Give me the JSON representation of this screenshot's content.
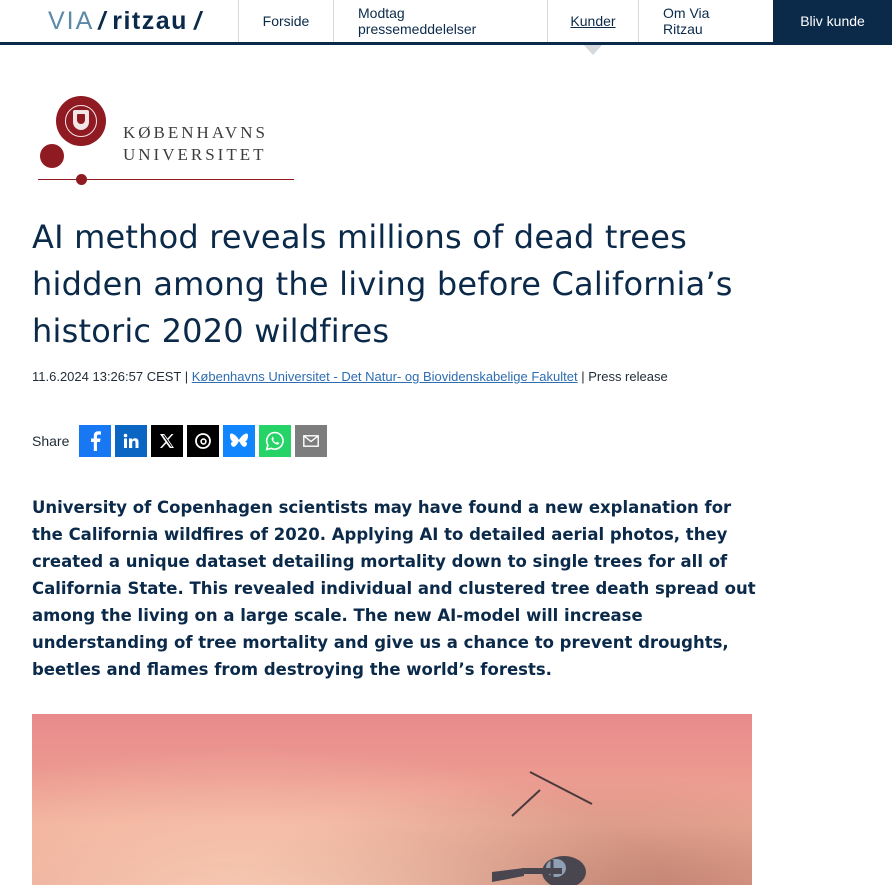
{
  "brand": {
    "via": "VIA",
    "name": "ritzau"
  },
  "nav": {
    "items": [
      {
        "label": "Forside"
      },
      {
        "label": "Modtag pressemeddelelser"
      },
      {
        "label": "Kunder"
      },
      {
        "label": "Om Via Ritzau"
      }
    ],
    "cta": "Bliv kunde"
  },
  "organization": {
    "line1": "KØBENHAVNS",
    "line2": "UNIVERSITET"
  },
  "article": {
    "title": "AI method reveals millions of dead trees hidden among the living before California’s historic 2020 wildfires",
    "date": "11.6.2024 13:26:57 CEST",
    "sep1": " | ",
    "source": "Københavns Universitet - Det Natur- og Biovidenskabelige Fakultet",
    "sep2": " | ",
    "type": "Press release",
    "lead": "University of Copenhagen scientists may have found a new explanation for the California wildfires of 2020. Applying AI to detailed aerial photos, they created a unique dataset detailing mortality down to single trees for all of California State. This revealed individual and clustered tree death spread out among the living on a large scale. The new AI-model will increase understanding of tree mortality and give us a chance to prevent droughts, beetles and flames from destroying the world’s forests."
  },
  "share": {
    "label": "Share",
    "icons": [
      "facebook-icon",
      "linkedin-icon",
      "x-icon",
      "threads-icon",
      "bluesky-icon",
      "whatsapp-icon",
      "email-icon"
    ]
  },
  "colors": {
    "navy": "#0b2a4a",
    "ku_red": "#8f1a22",
    "link": "#2f6db1",
    "facebook": "#1877f2",
    "linkedin": "#0a66c2",
    "bluesky": "#1185fe",
    "whatsapp": "#25d366"
  }
}
